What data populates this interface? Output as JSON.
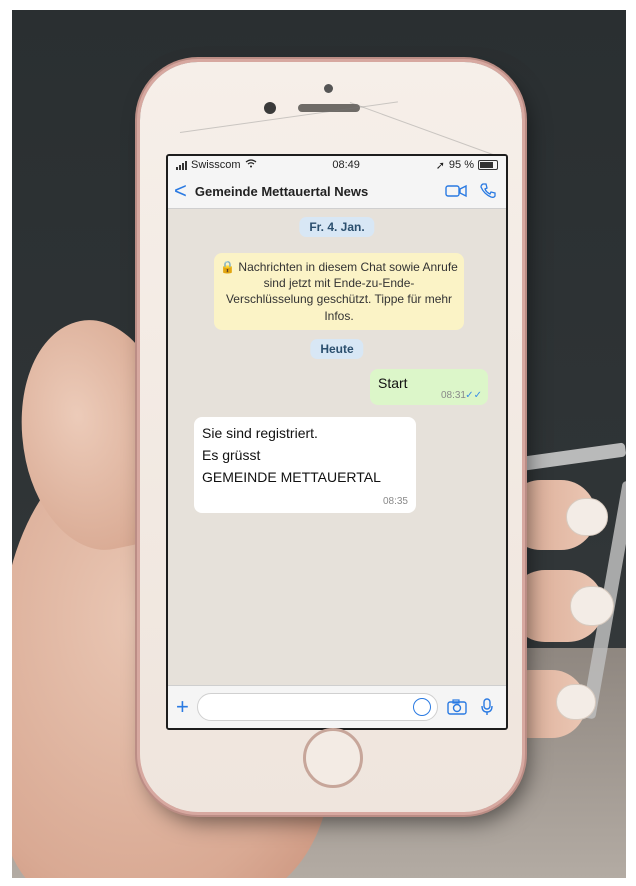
{
  "status_bar": {
    "carrier": "Swisscom",
    "time": "08:49",
    "battery": "95 %"
  },
  "chat_header": {
    "back_label": "<",
    "title": "Gemeinde Mettauertal News"
  },
  "chat": {
    "date_separator_1": "Fr. 4. Jan.",
    "encryption_notice": "🔒 Nachrichten in diesem Chat sowie Anrufe sind jetzt mit Ende-zu-Ende-Verschlüsselung geschützt. Tippe für mehr Infos.",
    "date_separator_2": "Heute",
    "outgoing": {
      "text": "Start",
      "time": "08:31",
      "ticks": "✓✓"
    },
    "incoming": {
      "line1": "Sie sind registriert.",
      "line2": "Es grüsst",
      "line3": "GEMEINDE METTAUERTAL",
      "time": "08:35"
    }
  },
  "input_bar": {
    "plus_label": "+"
  },
  "icons": {
    "video": "video-call-icon",
    "phone": "phone-call-icon",
    "camera": "camera-icon",
    "mic": "microphone-icon",
    "sticker": "sticker-icon"
  },
  "colors": {
    "accent": "#2a7ae2",
    "outgoing_bubble": "#dcf6c9",
    "notice": "#fbf3c6",
    "date_pill": "#d8e7f5"
  }
}
